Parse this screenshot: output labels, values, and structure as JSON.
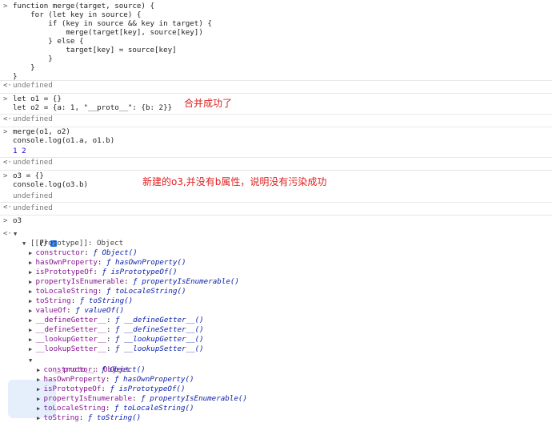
{
  "code_block_1": [
    "function merge(target, source) {",
    "    for (let key in source) {",
    "        if (key in source && key in target) {",
    "            merge(target[key], source[key])",
    "        } else {",
    "            target[key] = source[key]",
    "        }",
    "    }",
    "}"
  ],
  "result_1": "undefined",
  "code_block_2": [
    "let o1 = {}",
    "let o2 = {a: 1, \"__proto__\": {b: 2}}"
  ],
  "note_1": "合并成功了",
  "result_2": "undefined",
  "code_block_3": [
    "merge(o1, o2)",
    "console.log(o1.a, o1.b)"
  ],
  "log_output_1": "1 2",
  "result_3": "undefined",
  "code_block_4": [
    "o3 = {}",
    "console.log(o3.b)"
  ],
  "note_2": "新建的o3,并没有b属性，说明没有污染成功",
  "log_output_2": "undefined",
  "result_4": "undefined",
  "code_block_5": "o3",
  "object_tree": {
    "root_label": "{}",
    "info_icon": "i",
    "prototype_label": "[[Prototype]]: Object",
    "members": [
      {
        "key": "constructor",
        "value": "ƒ Object()"
      },
      {
        "key": "hasOwnProperty",
        "value": "ƒ hasOwnProperty()"
      },
      {
        "key": "isPrototypeOf",
        "value": "ƒ isPrototypeOf()"
      },
      {
        "key": "propertyIsEnumerable",
        "value": "ƒ propertyIsEnumerable()"
      },
      {
        "key": "toLocaleString",
        "value": "ƒ toLocaleString()"
      },
      {
        "key": "toString",
        "value": "ƒ toString()"
      },
      {
        "key": "valueOf",
        "value": "ƒ valueOf()"
      },
      {
        "key": "__defineGetter__",
        "value": "ƒ __defineGetter__()"
      },
      {
        "key": "__defineSetter__",
        "value": "ƒ __defineSetter__()"
      },
      {
        "key": "__lookupGetter__",
        "value": "ƒ __lookupGetter__()"
      },
      {
        "key": "__lookupSetter__",
        "value": "ƒ __lookupSetter__()"
      }
    ],
    "proto_label": "__proto__: Object",
    "proto_members": [
      {
        "key": "constructor",
        "value": "ƒ Object()"
      },
      {
        "key": "hasOwnProperty",
        "value": "ƒ hasOwnProperty()"
      },
      {
        "key": "isPrototypeOf",
        "value": "ƒ isPrototypeOf()"
      },
      {
        "key": "propertyIsEnumerable",
        "value": "ƒ propertyIsEnumerable()"
      },
      {
        "key": "toLocaleString",
        "value": "ƒ toLocaleString()"
      },
      {
        "key": "toString",
        "value": "ƒ toString()"
      }
    ]
  }
}
